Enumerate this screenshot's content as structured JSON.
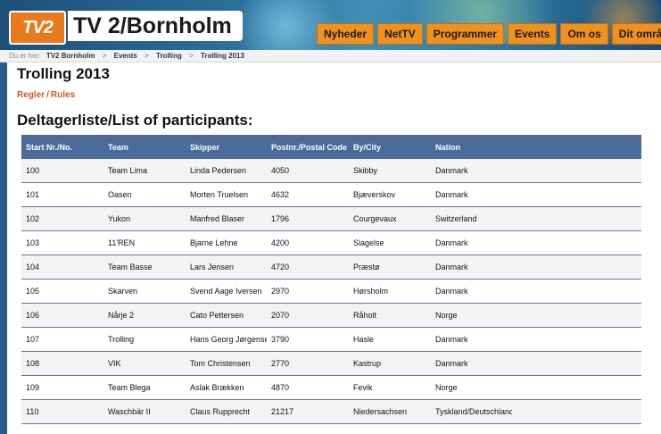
{
  "header": {
    "logo_text": "TV2",
    "site_title": "TV 2/Bornholm",
    "nav": [
      "Nyheder",
      "NetTV",
      "Programmer",
      "Events",
      "Om os",
      "Dit område"
    ]
  },
  "breadcrumb": {
    "prefix": "Du er her:",
    "items": [
      "TV2 Bornholm",
      "Events",
      "Trolling",
      "Trolling 2013"
    ]
  },
  "page": {
    "title": "Trolling 2013",
    "rules_regler": "Regler",
    "rules_sep": "/",
    "rules_rules": "Rules",
    "section_title": "Deltagerliste/List of participants:"
  },
  "table": {
    "headers": [
      "Start Nr./No.",
      "Team",
      "Skipper",
      "Postnr./Postal Code",
      "By/City",
      "Nation",
      ""
    ],
    "rows": [
      [
        "100",
        "Team Lima",
        "Linda Pedersen",
        "4050",
        "Skibby",
        "Danmark",
        ""
      ],
      [
        "101",
        "Oasen",
        "Morten  Truelsen",
        "4632",
        "Bjæverskov",
        "Danmark",
        ""
      ],
      [
        "102",
        "Yukon",
        "Manfred Blaser",
        "1796",
        "Courgevaux",
        "Switzerland",
        ""
      ],
      [
        "103",
        "11'REN",
        "Bjarne Lehne",
        "4200",
        "Slagelse",
        "Danmark",
        ""
      ],
      [
        "104",
        "Team Basse",
        "Lars Jensen",
        "4720",
        "Præstø",
        "Danmark",
        ""
      ],
      [
        "105",
        "Skarven",
        "Svend Aage Iversen",
        "2970",
        "Hørsholm",
        "Danmark",
        ""
      ],
      [
        "106",
        "Nårje 2",
        "Cato Pettersen",
        "2070",
        "Råholt",
        "Norge",
        ""
      ],
      [
        "107",
        "Trolling",
        "Hans Georg Jørgensen",
        "3790",
        "Hasle",
        "Danmark",
        ""
      ],
      [
        "108",
        "VIK",
        "Tom  Christensen",
        "2770",
        "Kastrup",
        "Danmark",
        ""
      ],
      [
        "109",
        "Team Blega",
        "Aslak Brækken",
        "4870",
        "Fevik",
        "Norge",
        ""
      ],
      [
        "110",
        "Waschbär II",
        "Claus Rupprecht",
        "21217",
        "Niedersachsen",
        "Tyskland/Deutschland",
        ""
      ]
    ]
  }
}
